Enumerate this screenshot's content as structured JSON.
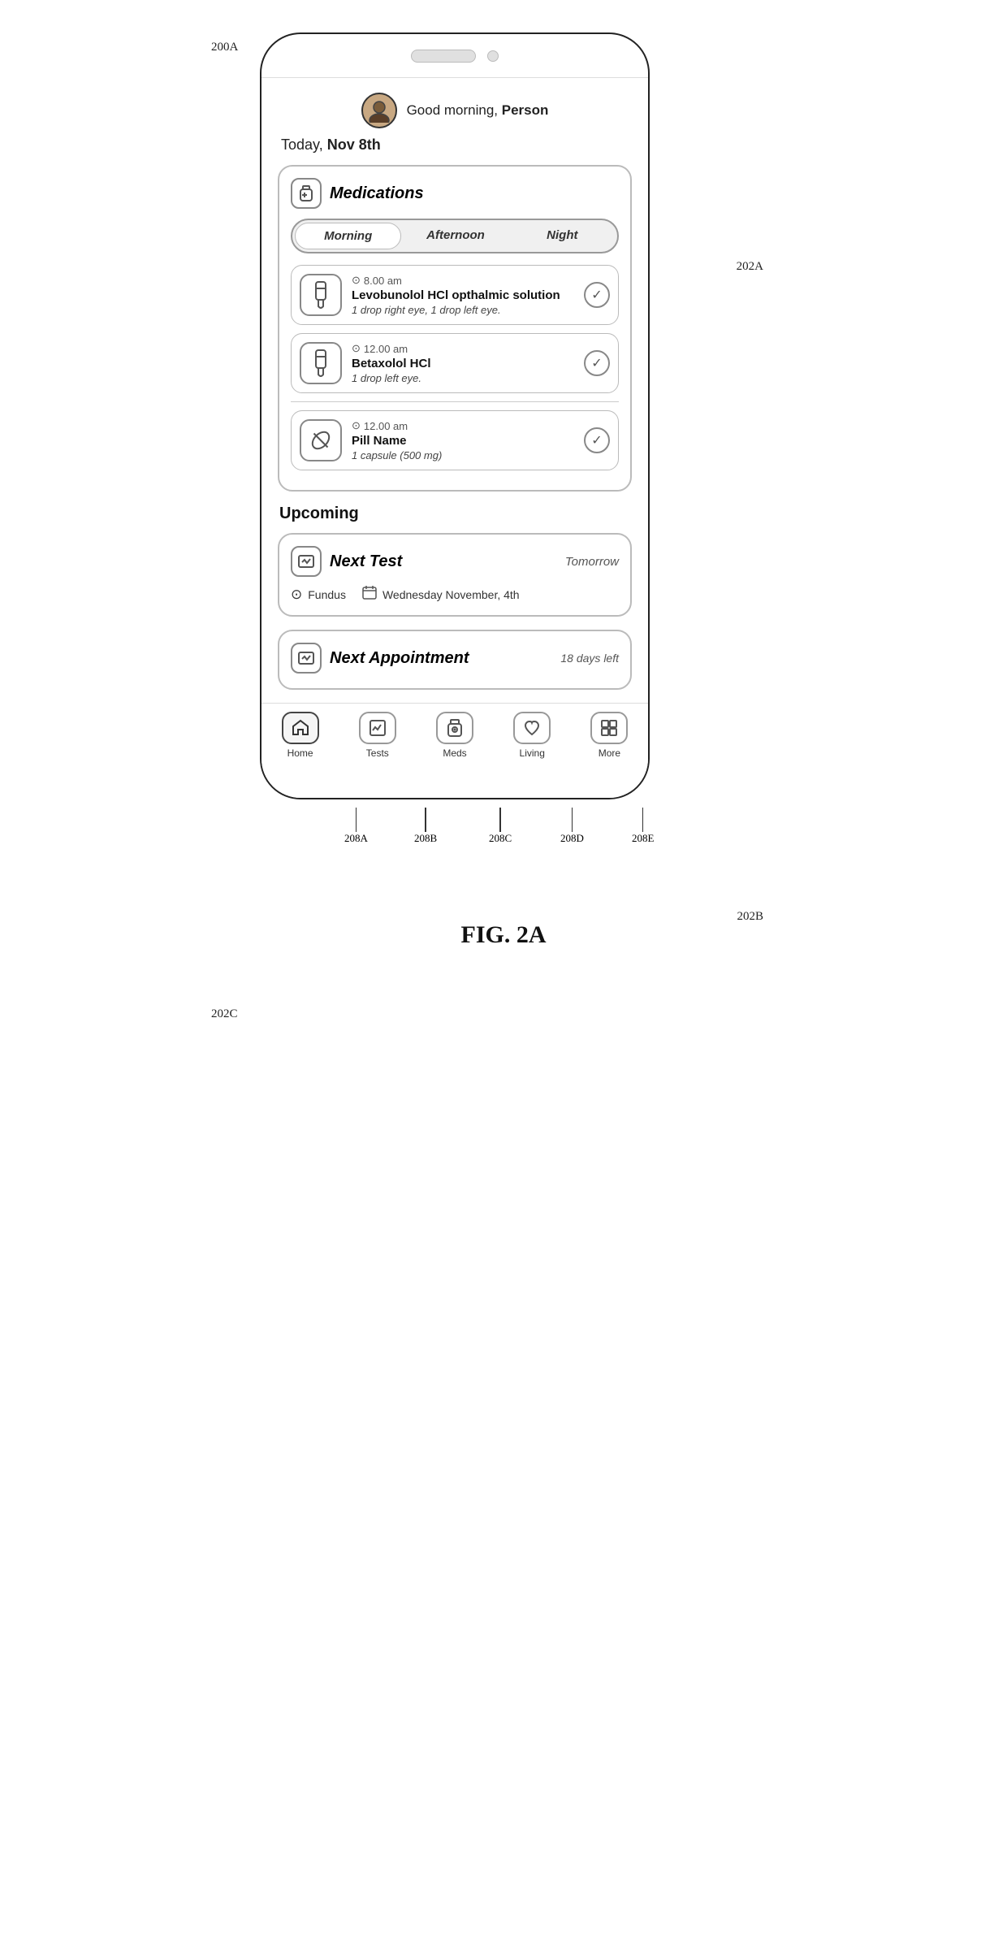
{
  "figure": {
    "label": "FIG. 2A",
    "annotation_200a": "200A",
    "annotation_202a": "202A",
    "annotation_202b": "202B",
    "annotation_202c": "202C",
    "annotation_208a": "208A",
    "annotation_208b": "208B",
    "annotation_208c": "208C",
    "annotation_208d": "208D",
    "annotation_208e": "208E"
  },
  "greeting": {
    "text": "Good morning, ",
    "name": "Person"
  },
  "date": {
    "label": "Today, ",
    "value": "Nov 8th"
  },
  "medications": {
    "title": "Medications",
    "tabs": [
      {
        "label": "Morning",
        "active": true
      },
      {
        "label": "Afternoon",
        "active": false
      },
      {
        "label": "Night",
        "active": false
      }
    ],
    "items": [
      {
        "time": "8.00 am",
        "name": "Levobunolol HCl opthalmic solution",
        "dosage": "1 drop right eye, 1 drop left eye.",
        "icon": "💧",
        "checked": true
      },
      {
        "time": "12.00 am",
        "name": "Betaxolol HCl",
        "dosage": "1 drop left eye.",
        "icon": "💧",
        "checked": true
      },
      {
        "time": "12.00 am",
        "name": "Pill Name",
        "dosage": "1 capsule (500 mg)",
        "icon": "💊",
        "checked": true
      }
    ]
  },
  "upcoming": {
    "title": "Upcoming",
    "next_test": {
      "title": "Next Test",
      "when": "Tomorrow",
      "type": "Fundus",
      "date": "Wednesday November, 4th"
    },
    "next_appointment": {
      "title": "Next Appointment",
      "days_left": "18 days left"
    }
  },
  "bottom_nav": {
    "items": [
      {
        "label": "Home",
        "icon": "⌂",
        "active": true
      },
      {
        "label": "Tests",
        "icon": "📈",
        "active": false
      },
      {
        "label": "Meds",
        "icon": "⊕",
        "active": false
      },
      {
        "label": "Living",
        "icon": "♡",
        "active": false
      },
      {
        "label": "More",
        "icon": "⊞",
        "active": false
      }
    ]
  }
}
